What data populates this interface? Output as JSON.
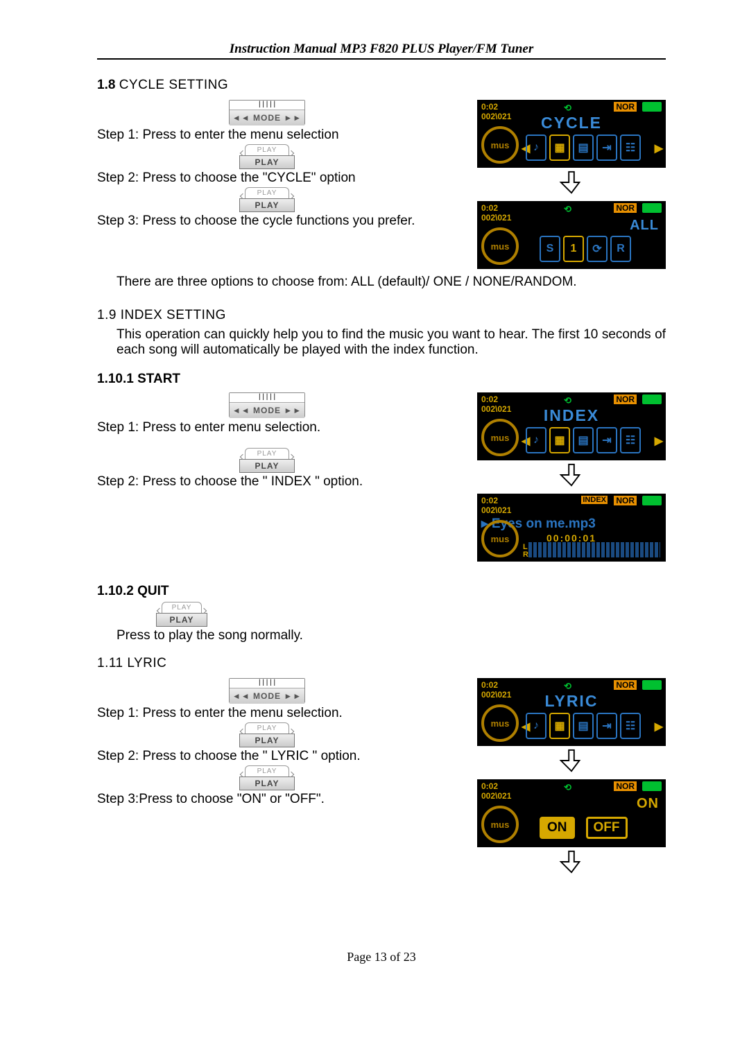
{
  "header": {
    "title": "Instruction Manual MP3 F820 PLUS Player/FM Tuner"
  },
  "sec18": {
    "heading_prefix": "1.8 ",
    "heading_title": "CYCLE SETTING",
    "step1": "Step 1: Press ",
    "step1b": " to enter the menu selection",
    "step2": "Step 2: Press ",
    "step2b": " to choose the \"CYCLE\" option",
    "step3": "Step 3: Press ",
    "step3b": " to choose the cycle functions you prefer.",
    "note": "There are three options to choose from: ALL (default)/ ONE / NONE/RANDOM."
  },
  "sec19": {
    "heading": "1.9 INDEX SETTING",
    "body": "This operation can quickly help you to find the music you want to hear.  The first 10 seconds of each song will automatically be played with the index function."
  },
  "sec1101": {
    "heading": "1.10.1 START",
    "step1": "Step 1: Press ",
    "step1b": " to enter menu selection.",
    "step2": "Step 2: Press ",
    "step2b": " to choose the \" INDEX \" option."
  },
  "sec1102": {
    "heading": "1.10.2 QUIT",
    "press": "Press ",
    "pressb": " to play the song normally."
  },
  "sec111": {
    "heading": "1.11 LYRIC",
    "step1": "Step 1: Press ",
    "step1b": " to enter the menu selection.",
    "step2": "Step 2: Press ",
    "step2b": " to choose the \" LYRIC \" option.",
    "step3": "Step 3:Press ",
    "step3b": " to choose \"ON\" or \"OFF\"."
  },
  "buttons": {
    "mode_top": "| | | | |",
    "mode_mid": "◄◄   MODE   ►►",
    "play_top": "PLAY",
    "play_mid": "PLAY"
  },
  "lcd": {
    "time": "0:02",
    "count": "002\\021",
    "loop": "⟲",
    "nor": "NOR",
    "idx": "INDEX",
    "mus": "mus",
    "cycle": "CYCLE",
    "all": "ALL",
    "index": "INDEX",
    "lyric": "LYRIC",
    "on": "ON",
    "off": "OFF",
    "song": "▸ Eyes on me.mp3",
    "timestamp": "00:00:01",
    "LR": "L\nR",
    "cycle_cells": [
      "♪",
      "▦",
      "▤",
      "⇥",
      "☷"
    ],
    "all_cells": [
      "S",
      "1",
      "⟳",
      "R"
    ]
  },
  "footer": "Page  13  of  23"
}
